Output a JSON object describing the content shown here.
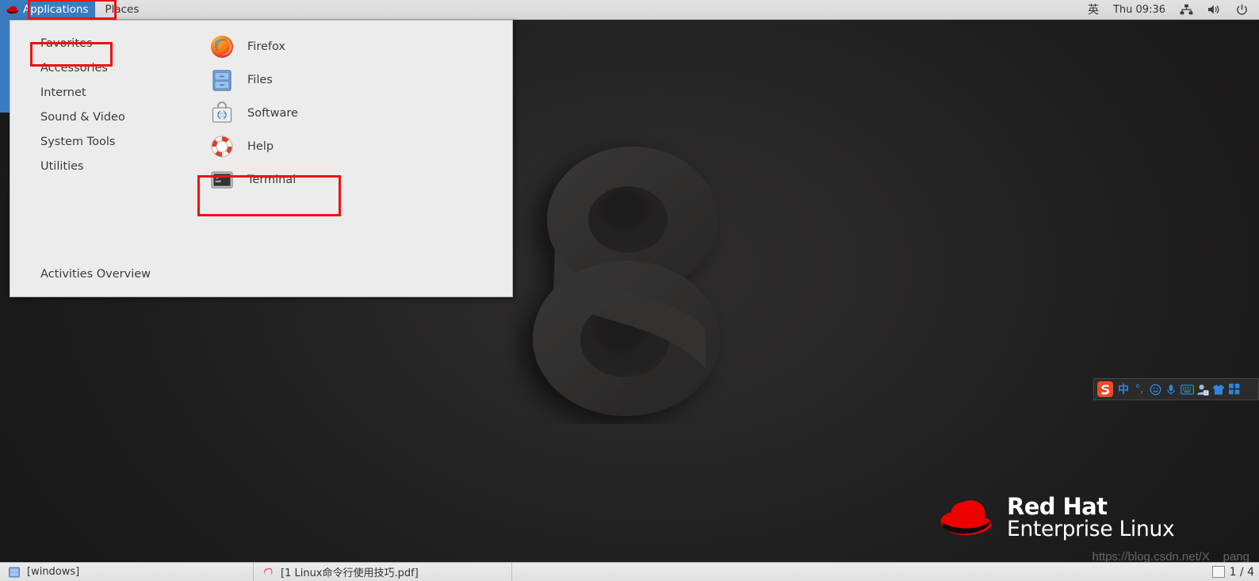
{
  "top_panel": {
    "applications_label": "Applications",
    "places_label": "Places",
    "ime_indicator": "英",
    "clock": "Thu 09:36",
    "tray_icons": [
      "network-icon",
      "volume-icon",
      "power-icon"
    ]
  },
  "app_menu": {
    "categories": [
      {
        "label": "Favorites",
        "highlighted": true
      },
      {
        "label": "Accessories",
        "highlighted": false
      },
      {
        "label": "Internet",
        "highlighted": false
      },
      {
        "label": "Sound & Video",
        "highlighted": false
      },
      {
        "label": "System Tools",
        "highlighted": false
      },
      {
        "label": "Utilities",
        "highlighted": false
      }
    ],
    "applications": [
      {
        "label": "Firefox",
        "icon": "firefox-icon"
      },
      {
        "label": "Files",
        "icon": "files-icon"
      },
      {
        "label": "Software",
        "icon": "software-icon"
      },
      {
        "label": "Help",
        "icon": "help-lifering-icon"
      },
      {
        "label": "Terminal",
        "icon": "terminal-icon"
      }
    ],
    "activities_overview_label": "Activities Overview"
  },
  "ime_bar": {
    "logo": "sogou-logo-icon",
    "items": [
      "chinese-mode-icon",
      "punctuation-icon",
      "emoji-icon",
      "microphone-icon",
      "soft-keyboard-icon",
      "user-icon",
      "skin-shirt-icon",
      "toolbox-grid-icon"
    ]
  },
  "branding": {
    "line1": "Red Hat",
    "line2": "Enterprise Linux",
    "hat_icon": "red-hat-fedora-icon"
  },
  "watermark": {
    "text": "https://blog.csdn.net/X__pang"
  },
  "taskbar": {
    "tasks": [
      {
        "label": "[windows]",
        "icon": "files-window-icon"
      },
      {
        "label": "[1 Linux命令行使用技巧.pdf]",
        "icon": "pdf-reader-icon"
      }
    ],
    "workspace": "1 / 4"
  },
  "colors": {
    "accent_blue": "#3b7bc0",
    "annotation_red": "#ee1111",
    "panel_gray": "#dcdcdc",
    "menu_gray": "#ececec",
    "desktop_dark": "#242323",
    "redhat_red": "#ee0000"
  }
}
